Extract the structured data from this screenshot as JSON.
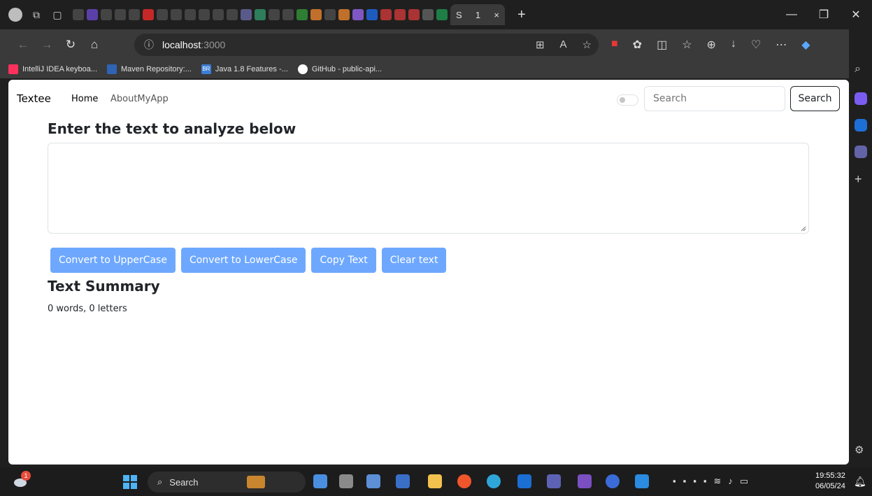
{
  "browser": {
    "url_host": "localhost",
    "url_port": ":3000",
    "favorites": [
      {
        "label": "IntelliJ IDEA keyboa...",
        "icon": "intellij-icon",
        "color": "#fe315d"
      },
      {
        "label": "Maven Repository:...",
        "icon": "maven-icon",
        "color": "#2f63b3"
      },
      {
        "label": "Java 1.8 Features -...",
        "icon": "br-icon",
        "color": "#3c7ed6",
        "badge": "BR"
      },
      {
        "label": "GitHub - public-api...",
        "icon": "github-icon",
        "color": "#ffffff"
      }
    ],
    "active_tab_label": "S",
    "active_tab_count": "1",
    "active_tab_close": "×",
    "new_tab": "+"
  },
  "app": {
    "brand": "Textee",
    "nav": {
      "home": "Home",
      "about": "AboutMyApp"
    },
    "search": {
      "placeholder": "Search",
      "button": "Search"
    },
    "heading": "Enter the text to analyze below",
    "buttons": {
      "upper": "Convert to UpperCase",
      "lower": "Convert to LowerCase",
      "copy": "Copy Text",
      "clear": "Clear text"
    },
    "summary": {
      "title": "Text Summary",
      "stats": "0 words, 0 letters"
    },
    "accent_color": "#6ea8fe"
  },
  "taskbar": {
    "search": "Search",
    "weather_badge": "1",
    "time": "19:55:32",
    "date": "06/05/24"
  }
}
